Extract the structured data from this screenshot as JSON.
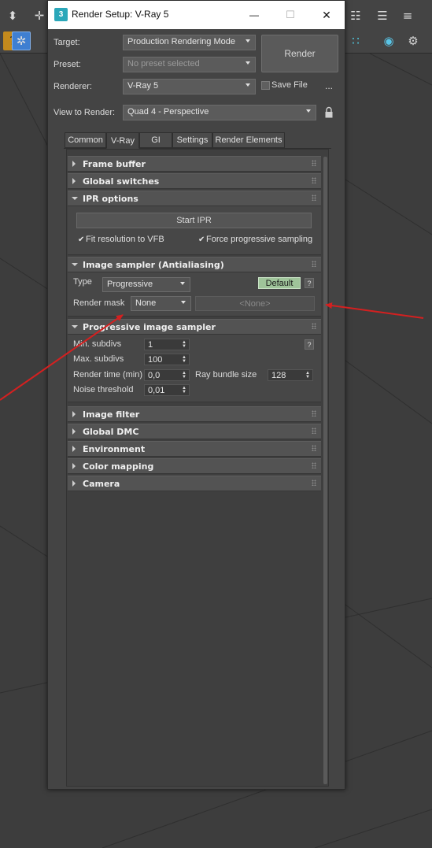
{
  "dialog": {
    "title": "Render Setup: V-Ray 5",
    "app_icon": "3",
    "minimize": "—",
    "maximize": "☐",
    "close": "✕"
  },
  "setup": {
    "target_label": "Target:",
    "target_value": "Production Rendering Mode",
    "preset_label": "Preset:",
    "preset_placeholder": "No preset selected",
    "renderer_label": "Renderer:",
    "renderer_value": "V-Ray 5",
    "render_button": "Render",
    "save_file_label": "Save File",
    "more_button": "...",
    "view_label": "View to Render:",
    "view_value": "Quad 4 - Perspective"
  },
  "tabs": [
    {
      "label": "Common"
    },
    {
      "label": "V-Ray"
    },
    {
      "label": "GI"
    },
    {
      "label": "Settings"
    },
    {
      "label": "Render Elements"
    }
  ],
  "active_tab": "V-Ray",
  "rollouts": {
    "frame_buffer": "Frame buffer",
    "global_switches": "Global switches",
    "ipr_options": {
      "title": "IPR options",
      "start_ipr": "Start IPR",
      "fit_resolution": "Fit resolution to VFB",
      "force_progressive": "Force progressive sampling",
      "checkmark": "✔"
    },
    "image_sampler": {
      "title": "Image sampler (Antialiasing)",
      "type_label": "Type",
      "type_value": "Progressive",
      "default_button": "Default",
      "help": "?",
      "render_mask_label": "Render mask",
      "render_mask_value": "None",
      "mask_object": "<None>"
    },
    "progressive": {
      "title": "Progressive image sampler",
      "min_subdivs_label": "Min. subdivs",
      "min_subdivs": "1",
      "max_subdivs_label": "Max. subdivs",
      "max_subdivs": "100",
      "render_time_label": "Render time (min)",
      "render_time": "0,0",
      "ray_bundle_label": "Ray bundle size",
      "ray_bundle": "128",
      "noise_label": "Noise threshold",
      "noise": "0,01",
      "help": "?"
    },
    "image_filter": "Image filter",
    "global_dmc": "Global DMC",
    "environment": "Environment",
    "color_mapping": "Color mapping",
    "camera": "Camera"
  },
  "annotation_color": "#d42020",
  "accent_default_button": "#9fc49a"
}
